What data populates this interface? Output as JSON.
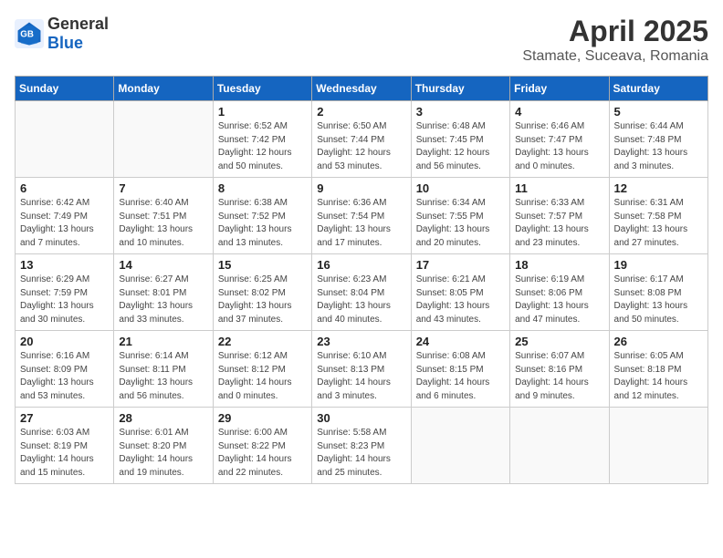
{
  "header": {
    "logo_general": "General",
    "logo_blue": "Blue",
    "month": "April 2025",
    "location": "Stamate, Suceava, Romania"
  },
  "weekdays": [
    "Sunday",
    "Monday",
    "Tuesday",
    "Wednesday",
    "Thursday",
    "Friday",
    "Saturday"
  ],
  "weeks": [
    [
      {
        "day": "",
        "info": ""
      },
      {
        "day": "",
        "info": ""
      },
      {
        "day": "1",
        "info": "Sunrise: 6:52 AM\nSunset: 7:42 PM\nDaylight: 12 hours and 50 minutes."
      },
      {
        "day": "2",
        "info": "Sunrise: 6:50 AM\nSunset: 7:44 PM\nDaylight: 12 hours and 53 minutes."
      },
      {
        "day": "3",
        "info": "Sunrise: 6:48 AM\nSunset: 7:45 PM\nDaylight: 12 hours and 56 minutes."
      },
      {
        "day": "4",
        "info": "Sunrise: 6:46 AM\nSunset: 7:47 PM\nDaylight: 13 hours and 0 minutes."
      },
      {
        "day": "5",
        "info": "Sunrise: 6:44 AM\nSunset: 7:48 PM\nDaylight: 13 hours and 3 minutes."
      }
    ],
    [
      {
        "day": "6",
        "info": "Sunrise: 6:42 AM\nSunset: 7:49 PM\nDaylight: 13 hours and 7 minutes."
      },
      {
        "day": "7",
        "info": "Sunrise: 6:40 AM\nSunset: 7:51 PM\nDaylight: 13 hours and 10 minutes."
      },
      {
        "day": "8",
        "info": "Sunrise: 6:38 AM\nSunset: 7:52 PM\nDaylight: 13 hours and 13 minutes."
      },
      {
        "day": "9",
        "info": "Sunrise: 6:36 AM\nSunset: 7:54 PM\nDaylight: 13 hours and 17 minutes."
      },
      {
        "day": "10",
        "info": "Sunrise: 6:34 AM\nSunset: 7:55 PM\nDaylight: 13 hours and 20 minutes."
      },
      {
        "day": "11",
        "info": "Sunrise: 6:33 AM\nSunset: 7:57 PM\nDaylight: 13 hours and 23 minutes."
      },
      {
        "day": "12",
        "info": "Sunrise: 6:31 AM\nSunset: 7:58 PM\nDaylight: 13 hours and 27 minutes."
      }
    ],
    [
      {
        "day": "13",
        "info": "Sunrise: 6:29 AM\nSunset: 7:59 PM\nDaylight: 13 hours and 30 minutes."
      },
      {
        "day": "14",
        "info": "Sunrise: 6:27 AM\nSunset: 8:01 PM\nDaylight: 13 hours and 33 minutes."
      },
      {
        "day": "15",
        "info": "Sunrise: 6:25 AM\nSunset: 8:02 PM\nDaylight: 13 hours and 37 minutes."
      },
      {
        "day": "16",
        "info": "Sunrise: 6:23 AM\nSunset: 8:04 PM\nDaylight: 13 hours and 40 minutes."
      },
      {
        "day": "17",
        "info": "Sunrise: 6:21 AM\nSunset: 8:05 PM\nDaylight: 13 hours and 43 minutes."
      },
      {
        "day": "18",
        "info": "Sunrise: 6:19 AM\nSunset: 8:06 PM\nDaylight: 13 hours and 47 minutes."
      },
      {
        "day": "19",
        "info": "Sunrise: 6:17 AM\nSunset: 8:08 PM\nDaylight: 13 hours and 50 minutes."
      }
    ],
    [
      {
        "day": "20",
        "info": "Sunrise: 6:16 AM\nSunset: 8:09 PM\nDaylight: 13 hours and 53 minutes."
      },
      {
        "day": "21",
        "info": "Sunrise: 6:14 AM\nSunset: 8:11 PM\nDaylight: 13 hours and 56 minutes."
      },
      {
        "day": "22",
        "info": "Sunrise: 6:12 AM\nSunset: 8:12 PM\nDaylight: 14 hours and 0 minutes."
      },
      {
        "day": "23",
        "info": "Sunrise: 6:10 AM\nSunset: 8:13 PM\nDaylight: 14 hours and 3 minutes."
      },
      {
        "day": "24",
        "info": "Sunrise: 6:08 AM\nSunset: 8:15 PM\nDaylight: 14 hours and 6 minutes."
      },
      {
        "day": "25",
        "info": "Sunrise: 6:07 AM\nSunset: 8:16 PM\nDaylight: 14 hours and 9 minutes."
      },
      {
        "day": "26",
        "info": "Sunrise: 6:05 AM\nSunset: 8:18 PM\nDaylight: 14 hours and 12 minutes."
      }
    ],
    [
      {
        "day": "27",
        "info": "Sunrise: 6:03 AM\nSunset: 8:19 PM\nDaylight: 14 hours and 15 minutes."
      },
      {
        "day": "28",
        "info": "Sunrise: 6:01 AM\nSunset: 8:20 PM\nDaylight: 14 hours and 19 minutes."
      },
      {
        "day": "29",
        "info": "Sunrise: 6:00 AM\nSunset: 8:22 PM\nDaylight: 14 hours and 22 minutes."
      },
      {
        "day": "30",
        "info": "Sunrise: 5:58 AM\nSunset: 8:23 PM\nDaylight: 14 hours and 25 minutes."
      },
      {
        "day": "",
        "info": ""
      },
      {
        "day": "",
        "info": ""
      },
      {
        "day": "",
        "info": ""
      }
    ]
  ]
}
